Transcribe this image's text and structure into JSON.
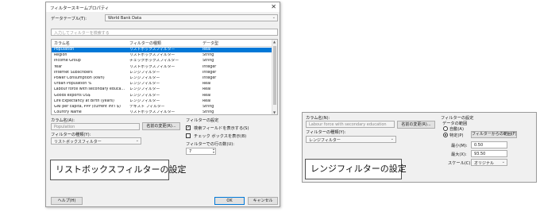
{
  "dialog": {
    "title": "フィルタースキームプロパティ",
    "close_glyph": "✕",
    "data_table_label": "データテーブル(T):",
    "data_table_value": "World Bank Data",
    "search_placeholder": "入力してフィルターを検索する",
    "columns": [
      "カラム名",
      "フィルターの種類",
      "データ型"
    ],
    "rows": [
      [
        "Population",
        "リストボックスフィルター",
        "Real"
      ],
      [
        "Region",
        "リストボックスフィルター",
        "String"
      ],
      [
        "Income Group",
        "チェックボックスフィルター",
        "String"
      ],
      [
        "Year",
        "リストボックスフィルター",
        "Integer"
      ],
      [
        "Internet Subscribers",
        "レンジフィルター",
        "Integer"
      ],
      [
        "Power Consumption (kWh)",
        "レンジフィルター",
        "Integer"
      ],
      [
        "Urban Population %",
        "レンジフィルター",
        "Real"
      ],
      [
        "Labour force with secondary educa...",
        "レンジフィルター",
        "Real"
      ],
      [
        "Goods exports US$",
        "レンジフィルター",
        "Real"
      ],
      [
        "Life Expectancy at Birth (years)",
        "レンジフィルター",
        "Real"
      ],
      [
        "GNI per capita, PPP (current int'l $)",
        "テキスト フィルター",
        "String"
      ],
      [
        "Country Name",
        "リストボックスフィルター",
        "String"
      ]
    ],
    "selected_row": 0,
    "column_name_label": "カラム名(A):",
    "column_name_value": "Population",
    "rename_button": "名前の変更(R)...",
    "filter_type_label": "フィルターの種類(Y):",
    "filter_type_value": "リストボックスフィルター",
    "filter_settings_label": "フィルターの設定",
    "search_field_checkbox": "検索フィールドを表示する(S)",
    "checkbox_show": "チェック ボックスを表示(B)",
    "rows_label": "フィルターでの行の数(U):",
    "rows_value": "7",
    "help_button": "ヘルプ(H)",
    "ok_button": "OK",
    "cancel_button": "キャンセル"
  },
  "caption_list": "リストボックスフィルターの設定",
  "range_panel": {
    "column_name_label": "カラム名(N):",
    "column_name_value": "Labour force with secondary education",
    "rename_button": "名前の変更(R)...",
    "filter_type_label": "フィルターの種類(Y):",
    "filter_type_value": "レンジフィルター",
    "filter_settings_label": "フィルターの設定",
    "data_range_label": "データの範囲",
    "radio_auto": "自動(A)",
    "radio_specific": "特定(P)",
    "from_filter_button": "フィルターからの範囲(F)",
    "min_label": "最小(M):",
    "min_value": "0.50",
    "max_label": "最大(X):",
    "max_value": "93.50",
    "scale_label": "スケール(C):",
    "scale_value": "オリジナル"
  },
  "caption_range": "レンジフィルターの設定",
  "icons": {
    "dropdown": "chevron-down-icon",
    "close": "close-icon"
  }
}
